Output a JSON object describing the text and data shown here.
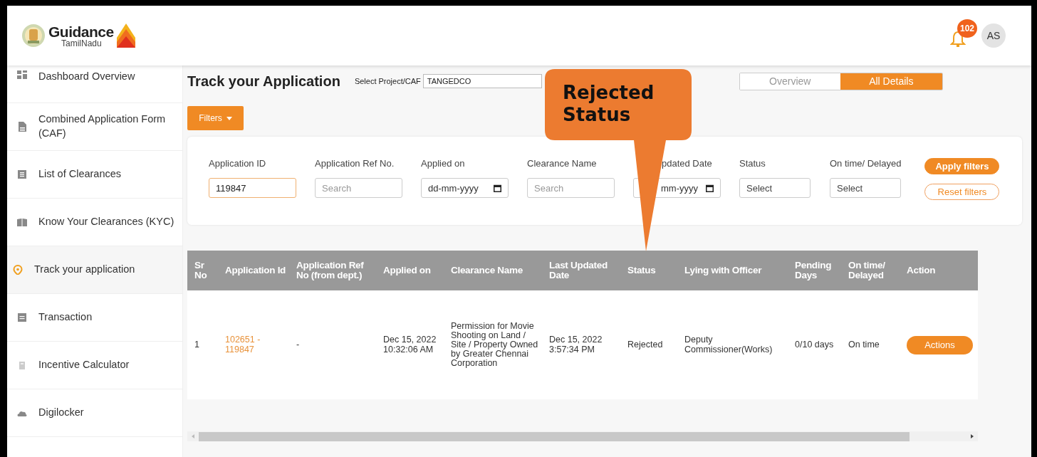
{
  "header": {
    "logo_title": "Guidance",
    "logo_subtitle": "TamilNadu",
    "notification_count": "102",
    "avatar": "AS"
  },
  "sidebar": {
    "items": [
      {
        "label": "Dashboard Overview",
        "selected": false
      },
      {
        "label": "Combined Application Form (CAF)",
        "selected": false
      },
      {
        "label": "List of Clearances",
        "selected": false
      },
      {
        "label": "Know Your Clearances (KYC)",
        "selected": false
      },
      {
        "label": "Track your application",
        "selected": true
      },
      {
        "label": "Transaction",
        "selected": false
      },
      {
        "label": "Incentive Calculator",
        "selected": false
      },
      {
        "label": "Digilocker",
        "selected": false
      }
    ]
  },
  "page": {
    "title": "Track your Application",
    "project_label": "Select Project/CAF",
    "project_value": "TANGEDCO"
  },
  "view_toggle": [
    {
      "label": "Overview",
      "selected": false
    },
    {
      "label": "All Details",
      "selected": true
    }
  ],
  "filters_button": "Filters",
  "filters": [
    {
      "label": "Application ID",
      "kind": "text",
      "value": "119847"
    },
    {
      "label": "Application Ref No.",
      "kind": "text",
      "placeholder": "Search"
    },
    {
      "label": "Applied on",
      "kind": "date",
      "placeholder": "dd-mm-yyyy"
    },
    {
      "label": "Clearance Name",
      "kind": "text",
      "placeholder": "Search"
    },
    {
      "label": "pdated Date",
      "kind": "date",
      "placeholder": "mm-yyyy"
    },
    {
      "label": "Status",
      "kind": "select",
      "placeholder": "Select"
    },
    {
      "label": "On time/ Delayed",
      "kind": "select",
      "placeholder": "Select"
    }
  ],
  "filter_actions": [
    {
      "label": "Apply filters",
      "kind": "primary"
    },
    {
      "label": "Reset filters",
      "kind": "outline"
    }
  ],
  "table": {
    "columns": [
      "Sr No",
      "Application Id",
      "Application Ref No (from dept.)",
      "Applied on",
      "Clearance Name",
      "Last Updated Date",
      "Status",
      "Lying with Officer",
      "Pending Days",
      "On time/ Delayed",
      "Action"
    ],
    "rows": [
      {
        "cells": [
          {
            "kind": "text",
            "text": "1"
          },
          {
            "kind": "link",
            "text": "102651 - 119847"
          },
          {
            "kind": "text",
            "text": "-"
          },
          {
            "kind": "text",
            "text": "Dec 15, 2022 10:32:06 AM"
          },
          {
            "kind": "text",
            "text": "Permission for Movie Shooting on Land / Site / Property Owned by Greater Chennai Corporation"
          },
          {
            "kind": "text",
            "text": "Dec 15, 2022 3:57:34 PM"
          },
          {
            "kind": "text",
            "text": "Rejected"
          },
          {
            "kind": "text",
            "text": "Deputy Commissioner(Works)"
          },
          {
            "kind": "text",
            "text": "0/10 days"
          },
          {
            "kind": "text",
            "text": "On time"
          },
          {
            "kind": "button",
            "text": "Actions"
          }
        ]
      }
    ]
  },
  "callout": {
    "text": "Rejected Status"
  }
}
